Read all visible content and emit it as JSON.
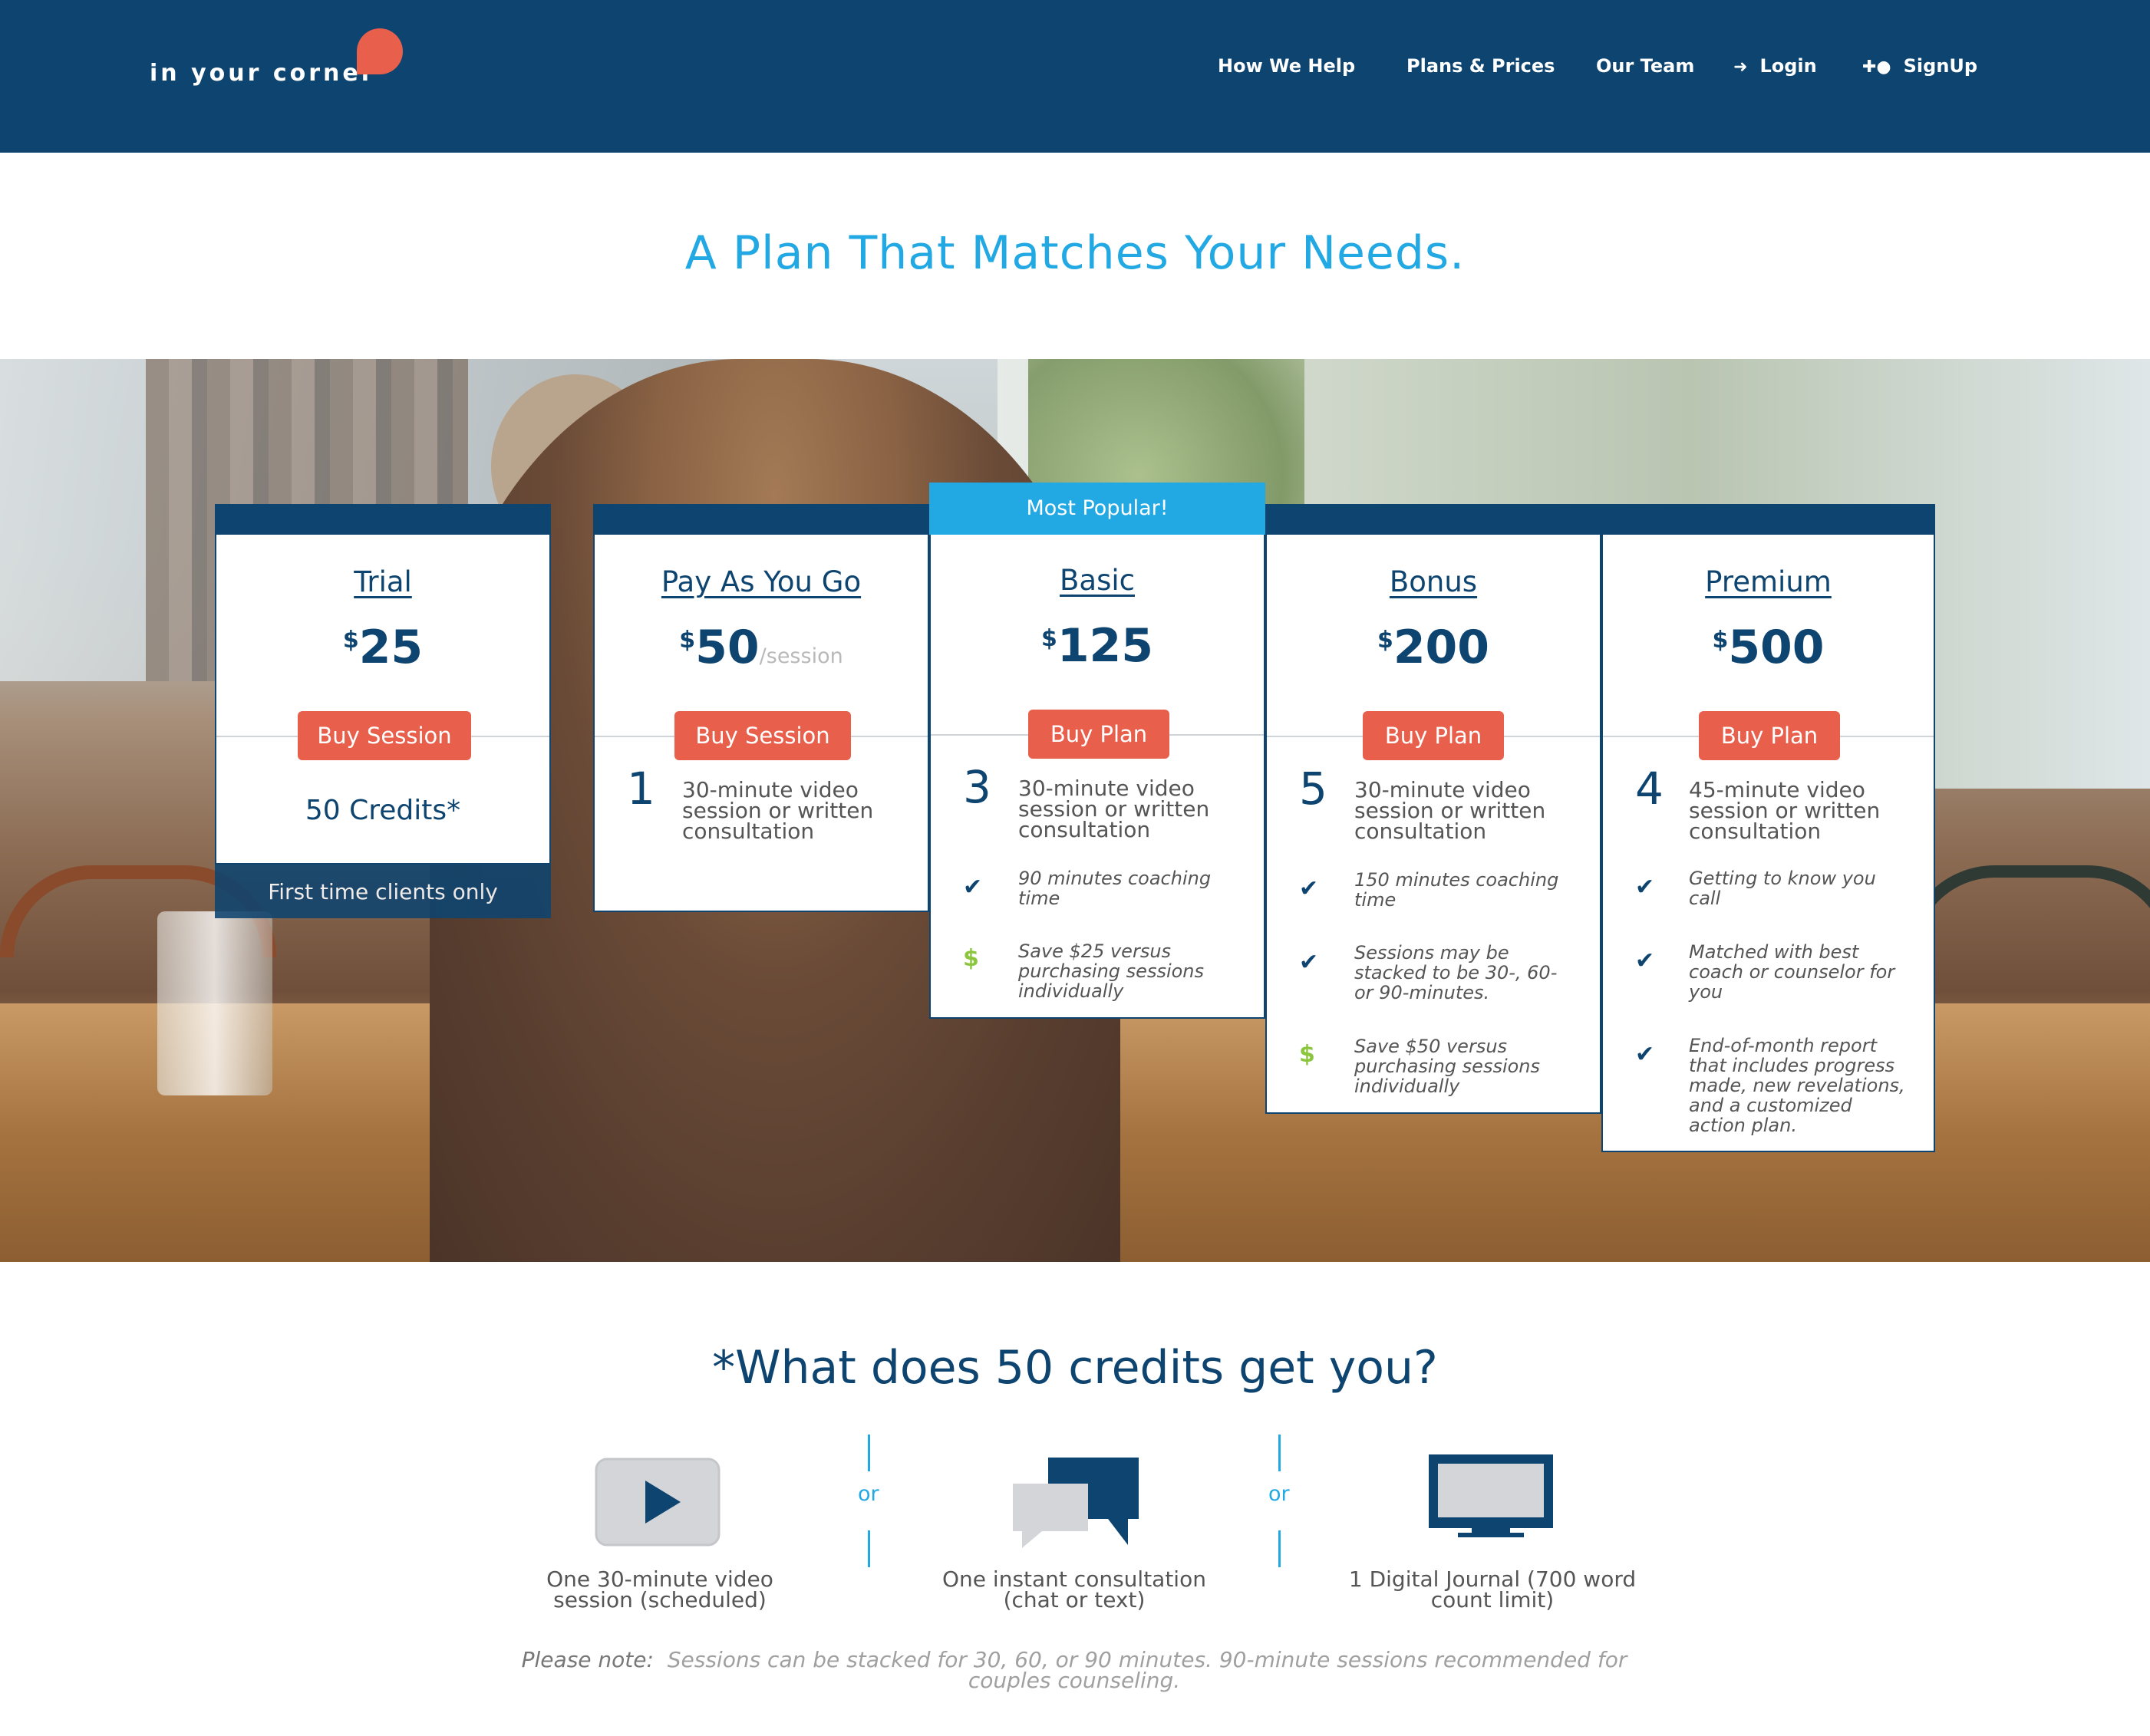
{
  "brand": {
    "logo_text": "in your corner"
  },
  "nav": {
    "how": "How We Help",
    "plans": "Plans & Prices",
    "team": "Our Team",
    "login": "Login",
    "signup": "SignUp"
  },
  "headline": "A Plan That Matches Your Needs.",
  "popular_label": "Most Popular!",
  "plans": [
    {
      "title": "Trial",
      "currency": "$",
      "amount": "25",
      "button": "Buy Session",
      "credits": "50 Credits*",
      "footer": "First time clients only"
    },
    {
      "title": "Pay As You Go",
      "currency": "$",
      "amount": "50",
      "per": "/session",
      "button": "Buy Session",
      "count": "1",
      "desc_l1": "30-minute video",
      "desc_l2": "session or written",
      "desc_l3": "consultation"
    },
    {
      "title": "Basic",
      "currency": "$",
      "amount": "125",
      "button": "Buy Plan",
      "count": "3",
      "desc_l1": "30-minute video",
      "desc_l2": "session or written",
      "desc_l3": "consultation",
      "features": [
        {
          "icon": "check-icon",
          "l1": "90 minutes coaching",
          "l2": "time"
        },
        {
          "icon": "dollar-icon",
          "l1": "Save $25 versus",
          "l2": "purchasing sessions",
          "l3": "individually"
        }
      ]
    },
    {
      "title": "Bonus",
      "currency": "$",
      "amount": "200",
      "button": "Buy Plan",
      "count": "5",
      "desc_l1": "30-minute video",
      "desc_l2": "session or written",
      "desc_l3": "consultation",
      "features": [
        {
          "icon": "check-icon",
          "l1": "150 minutes coaching",
          "l2": "time"
        },
        {
          "icon": "check-icon",
          "l1": "Sessions may be",
          "l2": "stacked to be 30-, 60-",
          "l3": "or 90-minutes."
        },
        {
          "icon": "dollar-icon",
          "l1": "Save $50 versus",
          "l2": "purchasing sessions",
          "l3": "individually"
        }
      ]
    },
    {
      "title": "Premium",
      "currency": "$",
      "amount": "500",
      "button": "Buy Plan",
      "count": "4",
      "desc_l1": "45-minute video",
      "desc_l2": "session or written",
      "desc_l3": "consultation",
      "features": [
        {
          "icon": "check-icon",
          "l1": "Getting to know you",
          "l2": "call"
        },
        {
          "icon": "check-icon",
          "l1": "Matched with best",
          "l2": "coach or counselor for",
          "l3": "you"
        },
        {
          "icon": "check-icon",
          "l1": "End-of-month report",
          "l2": "that includes progress",
          "l3": "made, new revelations,",
          "l4": "and a customized",
          "l5": "action plan."
        }
      ]
    }
  ],
  "credits_section": {
    "heading": "*What does 50 credits get you?",
    "options": [
      {
        "icon": "video-play-icon",
        "l1": "One 30-minute video",
        "l2": "session (scheduled)"
      },
      {
        "icon": "chat-bubbles-icon",
        "l1": "One instant consultation",
        "l2": "(chat or text)"
      },
      {
        "icon": "monitor-icon",
        "l1": "1 Digital Journal (700 word",
        "l2": "count limit)"
      }
    ],
    "or_text": "or",
    "note_lead": "Please note:",
    "note_l1": "Sessions can be stacked for 30, 60, or 90 minutes. 90-minute sessions recommended for",
    "note_l2": "couples counseling."
  },
  "colors": {
    "navy": "#0e4470",
    "accent_blue": "#22a8e2",
    "cta_red": "#e8604c",
    "save_green": "#8cc63f"
  }
}
